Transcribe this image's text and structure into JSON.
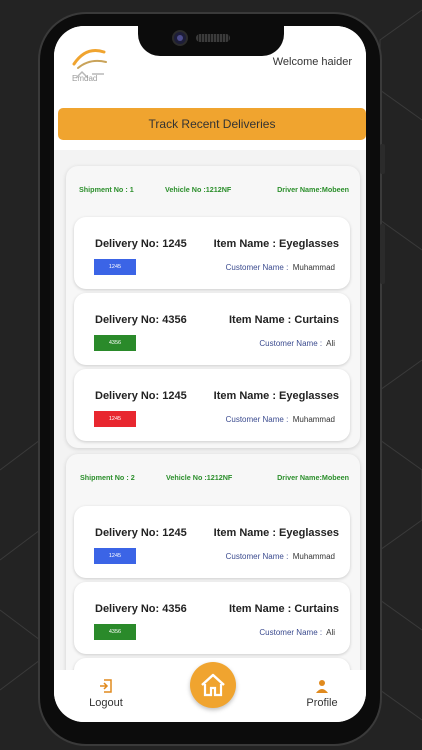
{
  "header": {
    "welcome_text": "Welcome  haider",
    "logo_text": "Emdad"
  },
  "track_button_label": "Track Recent Deliveries",
  "shipments": [
    {
      "shipment_no": "Shipment No : 1",
      "vehicle_no": "Vehicle No :1212NF",
      "driver_name": "Driver Name:Mobeen",
      "deliveries": [
        {
          "delivery_no": "Delivery No: 1245",
          "item": "Item Name :  Eyeglasses",
          "customer_label": "Customer Name :",
          "customer": "Muhammad",
          "badge": "1245",
          "badge_color": "#3b64e6"
        },
        {
          "delivery_no": "Delivery No: 4356",
          "item": "Item Name : Curtains",
          "customer_label": "Customer Name :",
          "customer": "Ali",
          "badge": "4356",
          "badge_color": "#2a8a2a"
        },
        {
          "delivery_no": "Delivery No: 1245",
          "item": "Item Name :  Eyeglasses",
          "customer_label": "Customer Name :",
          "customer": "Muhammad",
          "badge": "1245",
          "badge_color": "#e8272f"
        }
      ]
    },
    {
      "shipment_no": "Shipment No : 2",
      "vehicle_no": "Vehicle No :1212NF",
      "driver_name": "Driver Name:Mobeen",
      "deliveries": [
        {
          "delivery_no": "Delivery No: 1245",
          "item": "Item Name :  Eyeglasses",
          "customer_label": "Customer Name :",
          "customer": "Muhammad",
          "badge": "1245",
          "badge_color": "#3b64e6"
        },
        {
          "delivery_no": "Delivery No: 4356",
          "item": "Item Name : Curtains",
          "customer_label": "Customer Name :",
          "customer": "Ali",
          "badge": "4356",
          "badge_color": "#2a8a2a"
        }
      ]
    }
  ],
  "nav": {
    "logout_label": "Logout",
    "profile_label": "Profile",
    "logout_icon": "logout-icon",
    "home_icon": "home-icon",
    "profile_icon": "person-icon"
  },
  "colors": {
    "accent": "#f0a42f",
    "shipment_text": "#2c8f2c"
  }
}
